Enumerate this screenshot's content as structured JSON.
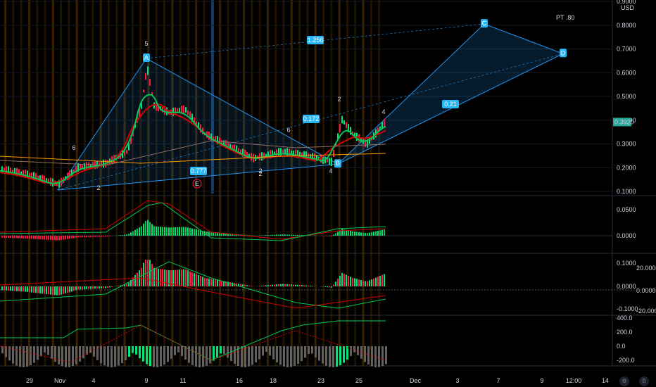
{
  "chart_data": {
    "type": "line",
    "currency_label": "USD",
    "price_axis": {
      "ticks": [
        "0.9000",
        "0.8000",
        "0.7000",
        "0.6000",
        "0.5000",
        "0.4000",
        "0.3000",
        "0.2000",
        "0.1000"
      ],
      "ylim": [
        0.1,
        0.9
      ]
    },
    "current_price": "0.3920",
    "current_price_color": "#26a69a",
    "date_axis": {
      "ticks": [
        "29",
        "Nov",
        "4",
        "9",
        "11",
        "16",
        "18",
        "23",
        "25",
        "Dec",
        "3",
        "7",
        "9",
        "12:00",
        "14"
      ]
    },
    "harmonic_pattern": {
      "points": [
        {
          "label": "A",
          "price": 0.66
        },
        {
          "label": "B",
          "price": 0.215
        },
        {
          "label": "C",
          "price": 0.805
        },
        {
          "label": "D",
          "price": 0.68
        }
      ],
      "ratios": [
        "1.256",
        "0.172",
        "0.21",
        "0.777"
      ],
      "note": "PT .80",
      "color": "#2196f3"
    },
    "elliott_marks": [
      "2",
      "6",
      "2",
      "4",
      "5",
      "6",
      "2",
      "4",
      "2",
      "E"
    ],
    "macd_panel": {
      "ticks": [
        "0.0500",
        "0.0000"
      ]
    },
    "oscillator_panel": {
      "ticks_left": [
        "0.1000",
        "0.0000",
        "-0.1000"
      ],
      "ticks_right": [
        "20.0000",
        "0.0000",
        "-20.0000"
      ]
    },
    "cci_panel": {
      "ticks": [
        "400.0",
        "200.0",
        "0.0",
        "-200.0"
      ]
    },
    "colors": {
      "up": "#00e676",
      "down": "#ff1744",
      "ema_green": "#00c853",
      "ema_red": "#d50000",
      "ema_orange": "#ff9800",
      "grid": "#1a1a1a"
    },
    "corner_buttons": [
      "⚙",
      "B"
    ]
  }
}
